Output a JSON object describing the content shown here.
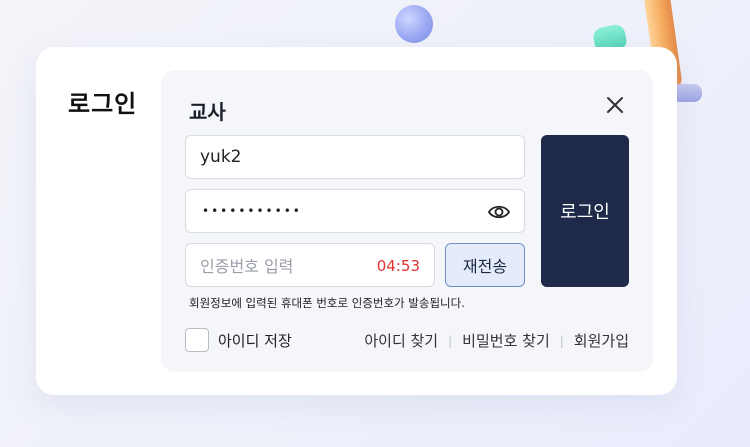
{
  "card": {
    "title": "로그인"
  },
  "panel": {
    "title": "교사"
  },
  "form": {
    "id_value": "yuk2",
    "password_masked": "•••••••••••",
    "code_placeholder": "인증번호 입력",
    "timer": "04:53",
    "resend_label": "재전송",
    "login_label": "로그인",
    "notice": "회원정보에 입력된 휴대폰 번호로 인증번호가 발송됩니다."
  },
  "options": {
    "save_id_label": "아이디 저장"
  },
  "links": {
    "find_id": "아이디 찾기",
    "find_pw": "비밀번호 찾기",
    "signup": "회원가입"
  },
  "icons": {
    "close": "close-icon",
    "eye": "eye-icon"
  },
  "colors": {
    "primary": "#1f2a4a",
    "timer": "#e0322f",
    "resend_bg": "#e4ecfb",
    "resend_border": "#6f8fc7"
  }
}
